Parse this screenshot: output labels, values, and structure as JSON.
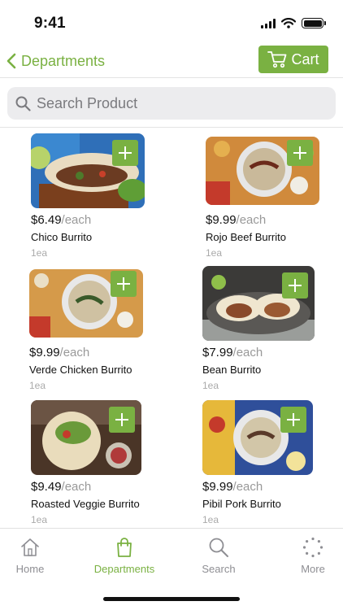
{
  "status_bar": {
    "time": "9:41"
  },
  "nav": {
    "back_label": "Departments",
    "cart_label": "Cart"
  },
  "search": {
    "placeholder": "Search Product"
  },
  "products": [
    {
      "price": "$6.49",
      "unit": "/each",
      "name": "Chico Burrito",
      "qty": "1ea"
    },
    {
      "price": "$9.99",
      "unit": "/each",
      "name": "Rojo Beef Burrito",
      "qty": "1ea"
    },
    {
      "price": "$9.99",
      "unit": "/each",
      "name": "Verde Chicken Burrito",
      "qty": "1ea"
    },
    {
      "price": "$7.99",
      "unit": "/each",
      "name": "Bean Burrito",
      "qty": "1ea"
    },
    {
      "price": "$9.49",
      "unit": "/each",
      "name": "Roasted Veggie Burrito",
      "qty": "1ea"
    },
    {
      "price": "$9.99",
      "unit": "/each",
      "name": "Pibil Pork Burrito",
      "qty": "1ea"
    }
  ],
  "tabs": [
    {
      "label": "Home",
      "icon": "home-icon"
    },
    {
      "label": "Departments",
      "icon": "shopping-bag-icon"
    },
    {
      "label": "Search",
      "icon": "search-icon"
    },
    {
      "label": "More",
      "icon": "more-icon"
    }
  ],
  "colors": {
    "accent": "#7ab142"
  }
}
